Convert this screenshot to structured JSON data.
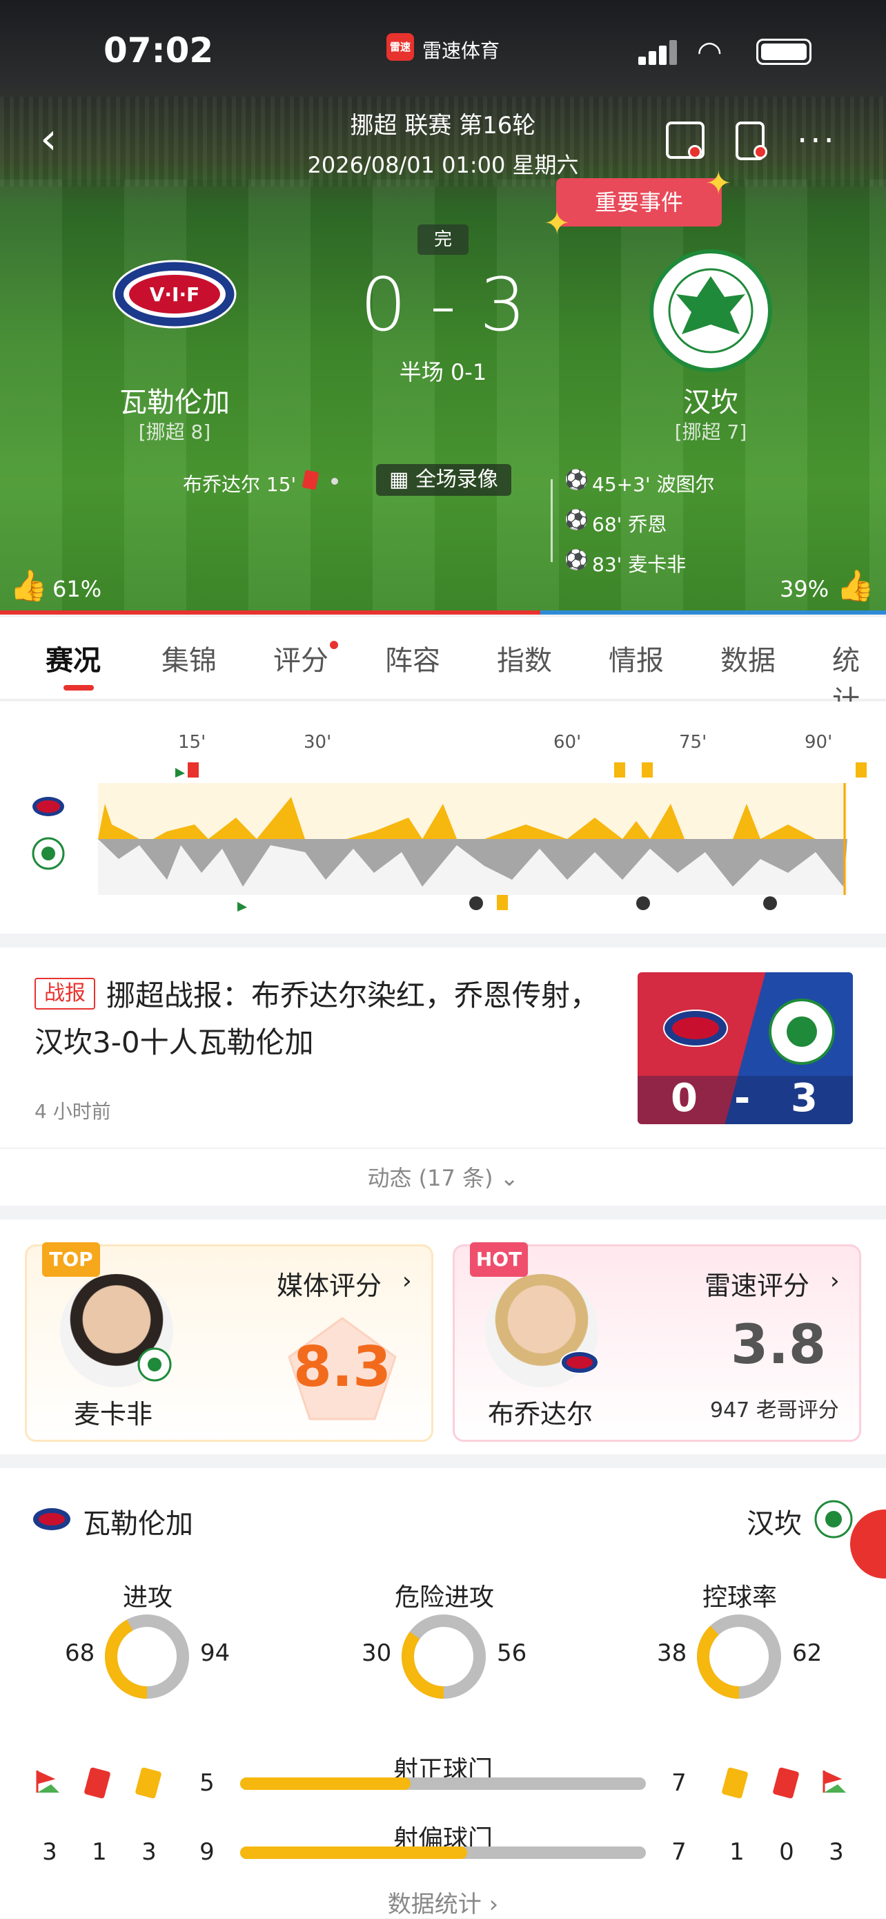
{
  "status": {
    "time": "07:02",
    "app_badge": "雷速",
    "app_name": "雷速体育"
  },
  "match": {
    "league": "挪超 联赛 第16轮",
    "datetime": "2026/08/01 01:00 星期六",
    "state": "完",
    "score": "0 - 3",
    "halftime": "半场 0-1",
    "home": {
      "name": "瓦勒伦加",
      "rank": "[挪超 8]",
      "events": [
        "布乔达尔 15'"
      ],
      "support": "61%",
      "color": "#1c3a8c"
    },
    "away": {
      "name": "汉坎",
      "rank": "[挪超 7]",
      "events": [
        "45+3' 波图尔",
        "68' 乔恩",
        "83' 麦卡非"
      ],
      "support": "39%",
      "color": "#1f8a3a"
    },
    "video": "全场录像",
    "event_tip": "重要事件"
  },
  "tabs": [
    "赛况",
    "集锦",
    "评分",
    "阵容",
    "指数",
    "情报",
    "数据",
    "统计"
  ],
  "timeline": {
    "ticks": [
      "15'",
      "30'",
      "60'",
      "75'",
      "90'"
    ]
  },
  "news": {
    "tag": "战报",
    "title": "挪超战报：布乔达尔染红，乔恩传射，汉坎3-0十人瓦勒伦加",
    "time": "4 小时前",
    "img_score": [
      "0",
      "-",
      "3"
    ]
  },
  "dynamic": "动态 (17 条)",
  "ratings": {
    "top": {
      "badge": "TOP",
      "label": "媒体评分",
      "name": "麦卡非",
      "score": "8.3"
    },
    "hot": {
      "badge": "HOT",
      "label": "雷速评分",
      "name": "布乔达尔",
      "score": "3.8",
      "votes": "947 老哥评分"
    }
  },
  "stats": {
    "home": "瓦勒伦加",
    "away": "汉坎",
    "rings": [
      {
        "label": "进攻",
        "home": "68",
        "away": "94",
        "home_frac": 0.42
      },
      {
        "label": "危险进攻",
        "home": "30",
        "away": "56",
        "home_frac": 0.35
      },
      {
        "label": "控球率",
        "home": "38",
        "away": "62",
        "home_frac": 0.38
      }
    ],
    "bars": [
      {
        "label": "射正球门",
        "home": "5",
        "away": "7",
        "home_frac": 0.42
      },
      {
        "label": "射偏球门",
        "home": "9",
        "away": "7",
        "home_frac": 0.56
      }
    ],
    "home_cards": [
      "3",
      "1",
      "3"
    ],
    "away_cards": [
      "1",
      "0",
      "3"
    ],
    "more": "数据统计"
  },
  "colors": {
    "accent": "#e8322e",
    "home_bar": "#f6b70e",
    "away_bar": "#bdbdbd"
  }
}
